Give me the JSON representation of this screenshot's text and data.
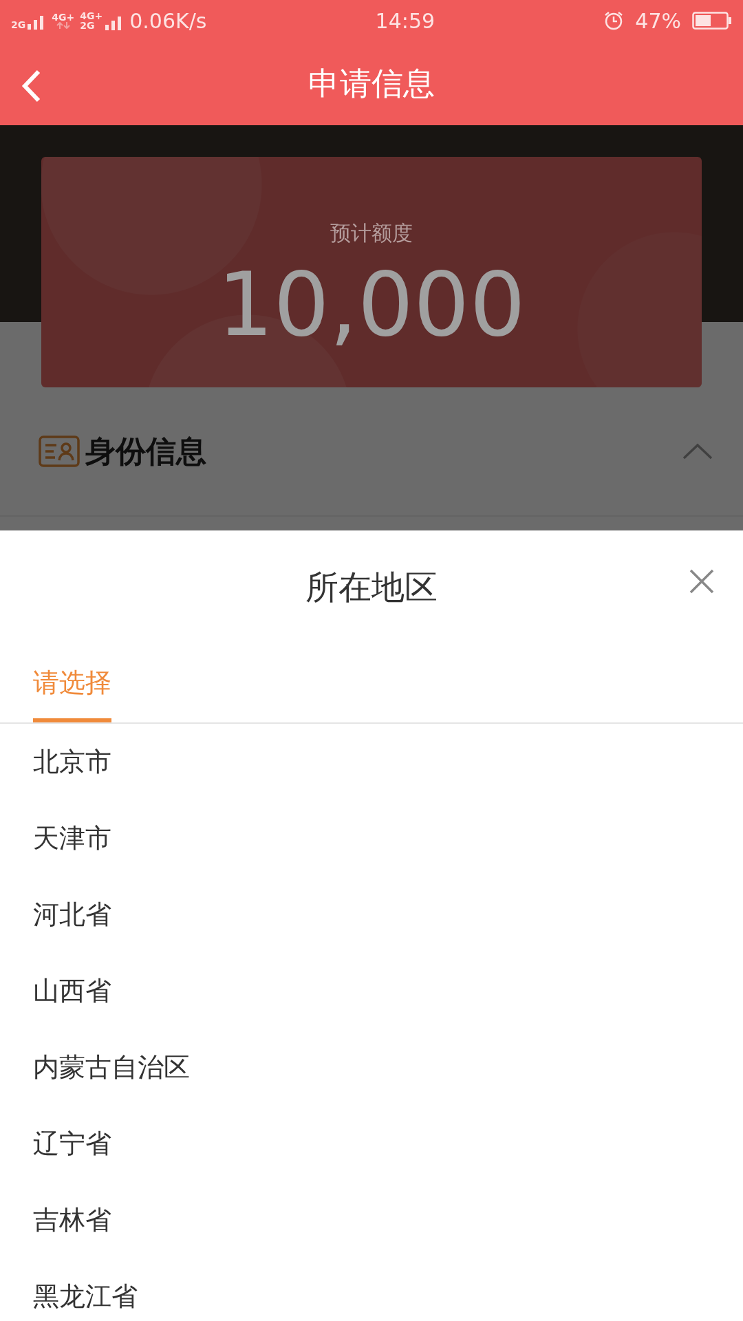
{
  "status_bar": {
    "signal_labels": [
      "2G",
      "4G+",
      "4G+",
      "2G"
    ],
    "speed": "0.06K/s",
    "time": "14:59",
    "battery": "47%"
  },
  "header": {
    "title": "申请信息"
  },
  "quota": {
    "label": "预计额度",
    "amount": "10,000"
  },
  "section": {
    "title": "身份信息",
    "expanded": true
  },
  "sheet": {
    "title": "所在地区",
    "tabs": [
      {
        "label": "请选择",
        "selected": true
      }
    ],
    "items": [
      {
        "label": "北京市"
      },
      {
        "label": "天津市"
      },
      {
        "label": "河北省"
      },
      {
        "label": "山西省"
      },
      {
        "label": "内蒙古自治区"
      },
      {
        "label": "辽宁省"
      },
      {
        "label": "吉林省"
      },
      {
        "label": "黑龙江省"
      }
    ]
  }
}
